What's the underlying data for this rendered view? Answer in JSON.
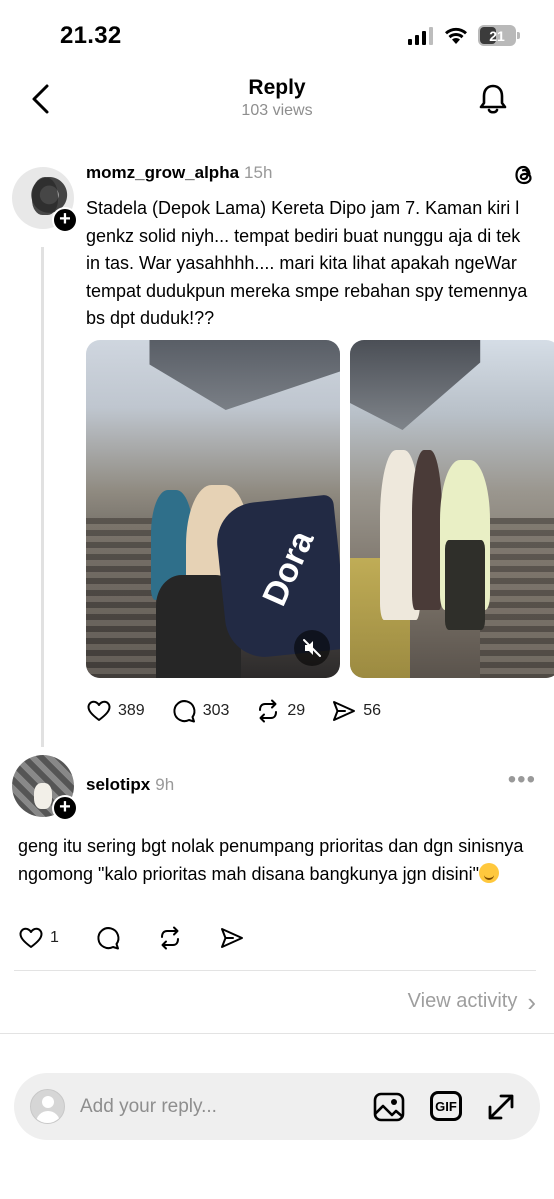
{
  "status_bar": {
    "time": "21.32",
    "battery_level": "21"
  },
  "header": {
    "title": "Reply",
    "subtitle": "103 views"
  },
  "post": {
    "username": "momz_grow_alpha",
    "time": "15h",
    "text": "Stadela (Depok Lama) Kereta Dipo jam 7. Kaman kiri l genkz solid niyh... tempat bediri buat nunggu aja di tek in tas. War yasahhhh.... mari kita lihat apakah ngeWar tempat dudukpun mereka smpe rebahan spy temennya bs dpt duduk!??",
    "media_bag_text": "Dora",
    "stats": {
      "likes": "389",
      "replies": "303",
      "reposts": "29",
      "shares": "56"
    }
  },
  "reply": {
    "username": "selotipx",
    "time": "9h",
    "text": "geng itu sering bgt nolak penumpang prioritas dan dgn sinisnya ngomong \"kalo prioritas mah disana bangkunya jgn disini\"",
    "likes": "1",
    "more": "•••"
  },
  "view_activity": {
    "label": "View activity",
    "chevron": "›"
  },
  "composer": {
    "placeholder": "Add your reply...",
    "gif_label": "GIF"
  },
  "icons": [
    "back-icon",
    "bell-icon",
    "threads-icon",
    "heart-icon",
    "comment-icon",
    "repost-icon",
    "send-icon",
    "mute-icon",
    "image-icon",
    "gif-icon",
    "expand-icon",
    "more-icon",
    "chevron-right-icon"
  ]
}
